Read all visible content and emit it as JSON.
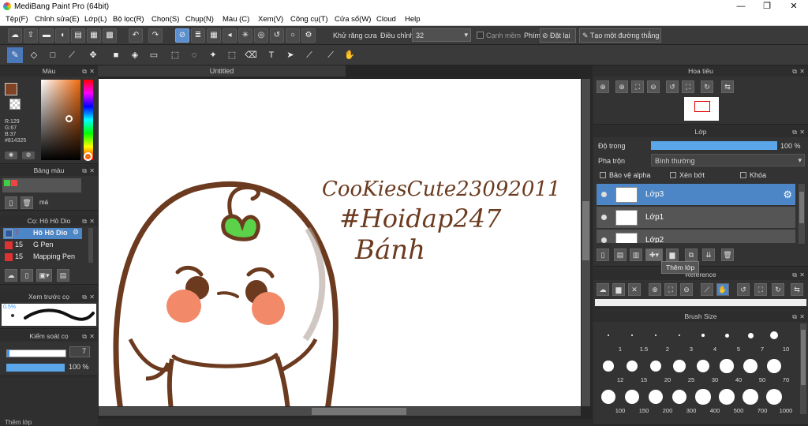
{
  "window": {
    "title": "MediBang Paint Pro (64bit)",
    "min": "—",
    "max": "❐",
    "close": "✕"
  },
  "menu": [
    "Tệp(F)",
    "Chỉnh sửa(E)",
    "Lớp(L)",
    "Bộ lọc(R)",
    "Chọn(S)",
    "Chụp(N)",
    "Màu (C)",
    "Xem(V)",
    "Công cụ(T)",
    "Cửa số(W)",
    "Cloud",
    "Help"
  ],
  "toolbar1": {
    "antialias": "Khử răng cưa",
    "correction_label": "Điều chỉnh",
    "correction_value": "32",
    "edge": "Cạnh mềm",
    "keys_label": "Phím",
    "reset": "Đặt lại",
    "straight": "Tạo một đường thẳng"
  },
  "canvas": {
    "tab": "Untitled",
    "line1": "CooKiesCute23092011",
    "line2": "#Hoidap247",
    "line3": "Bánh"
  },
  "color_panel": {
    "title": "Màu",
    "r": "R:129",
    "g": "G:67",
    "b": "B:37",
    "hex": "#814325",
    "primary": "#814325"
  },
  "palette_panel": {
    "title": "Bảng màu",
    "name": "má"
  },
  "brush_panel": {
    "title": "Cọ: Hô Hô Dio",
    "items": [
      {
        "size": "7",
        "name": "Hô Hô Dio",
        "color": "#2c5aa0"
      },
      {
        "size": "15",
        "name": "G Pen",
        "color": "#d33"
      },
      {
        "size": "15",
        "name": "Mapping Pen",
        "color": "#d33"
      }
    ]
  },
  "preview_panel": {
    "title": "Xem trước cọ",
    "size": "0.5%"
  },
  "brush_control": {
    "title": "Kiểm soát cọ",
    "size": "7",
    "opacity": "100 %"
  },
  "status": "Thêm lớp",
  "navigator": {
    "title": "Hoa tiêu"
  },
  "layer_panel": {
    "title": "Lớp",
    "opacity_label": "Độ trong",
    "opacity_value": "100 %",
    "opacity": 1.0,
    "blend_label": "Pha trộn",
    "blend_value": "Bình thường",
    "alpha": "Bảo vệ alpha",
    "clip": "Xén bớt",
    "lock": "Khóa",
    "layers": [
      "Lớp3",
      "Lớp1",
      "Lớp2"
    ],
    "tooltip": "Thêm lớp"
  },
  "reference_panel": {
    "title": "Reference"
  },
  "brushsize_panel": {
    "title": "Brush Size",
    "sizes": [
      "1",
      "1.5",
      "2",
      "3",
      "4",
      "5",
      "7",
      "10",
      "12",
      "15",
      "20",
      "25",
      "30",
      "40",
      "50",
      "70",
      "100",
      "150",
      "200",
      "300",
      "400",
      "500",
      "700",
      "1000"
    ]
  }
}
